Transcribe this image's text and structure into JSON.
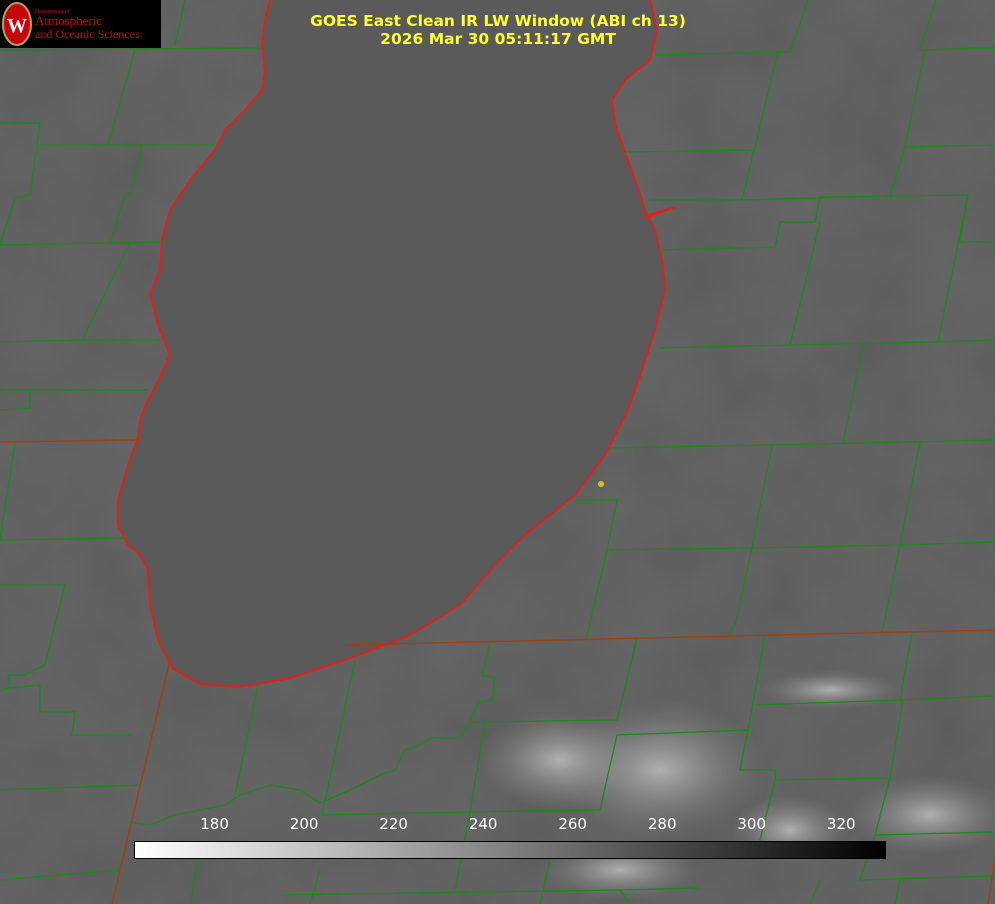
{
  "title": {
    "line1": "GOES East Clean IR LW Window (ABI ch 13)",
    "line2": "2026 Mar 30 05:11:17 GMT"
  },
  "logo": {
    "dept": "Department of",
    "line1": "Atmospheric",
    "line2": "and Oceanic Sciences",
    "seal_letter": "W"
  },
  "colorbar": {
    "ticks": [
      "180",
      "200",
      "220",
      "240",
      "260",
      "280",
      "300",
      "320"
    ],
    "range": [
      162,
      330
    ]
  },
  "colors": {
    "county_lines": "#1a8a1a",
    "shoreline": "#e0201a",
    "state_lines": "#a04010",
    "title_text": "#ffff33",
    "marker": "#d4c020"
  }
}
